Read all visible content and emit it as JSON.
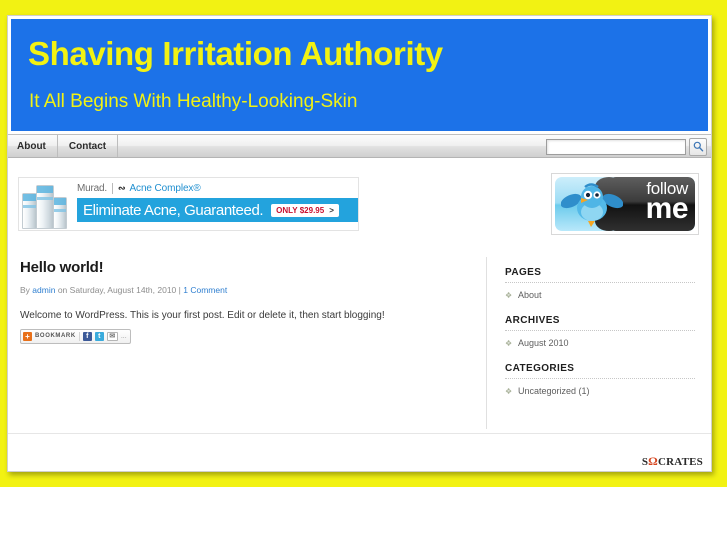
{
  "theme": {
    "page_background": "#f2f213",
    "header_background": "#1c72e8",
    "header_text_color": "#f2f213",
    "link_color": "#2f7fd0",
    "ad_bar_color": "#23a3dd"
  },
  "header": {
    "site_title": "Shaving Irritation Authority",
    "tagline": "It All Begins With Healthy-Looking-Skin"
  },
  "nav": {
    "items": [
      {
        "label": "About"
      },
      {
        "label": "Contact"
      }
    ],
    "search": {
      "value": "",
      "placeholder": "",
      "button_icon": "search-icon"
    }
  },
  "ad": {
    "brand": "Murad.",
    "product": "Acne Complex®",
    "headline": "Eliminate Acne, Guaranteed.",
    "cta_label": "ONLY $29.95",
    "cta_arrow": ">"
  },
  "follow_badge": {
    "line1": "follow",
    "line2": "me",
    "icon": "twitter-bird-icon"
  },
  "post": {
    "title": "Hello world!",
    "meta_by": "By",
    "meta_author": "admin",
    "meta_on": "on Saturday, August 14th, 2010",
    "meta_separator": "|",
    "meta_comments": "1 Comment",
    "body": "Welcome to WordPress. This is your first post. Edit or delete it, then start blogging!",
    "bookmark": {
      "plus": "+",
      "label": "BOOKMARK",
      "facebook": "f",
      "twitter": "t",
      "email": "✉",
      "more": "..."
    }
  },
  "sidebar": {
    "widgets": [
      {
        "title": "PAGES",
        "items": [
          {
            "bullet": "❖",
            "label": "About"
          }
        ]
      },
      {
        "title": "ARCHIVES",
        "items": [
          {
            "bullet": "❖",
            "label": "August 2010"
          }
        ]
      },
      {
        "title": "CATEGORIES",
        "items": [
          {
            "bullet": "❖",
            "label": "Uncategorized (1)"
          }
        ]
      }
    ]
  },
  "footer": {
    "logo_prefix": "S",
    "logo_omega": "Ω",
    "logo_suffix": "CRATES"
  }
}
